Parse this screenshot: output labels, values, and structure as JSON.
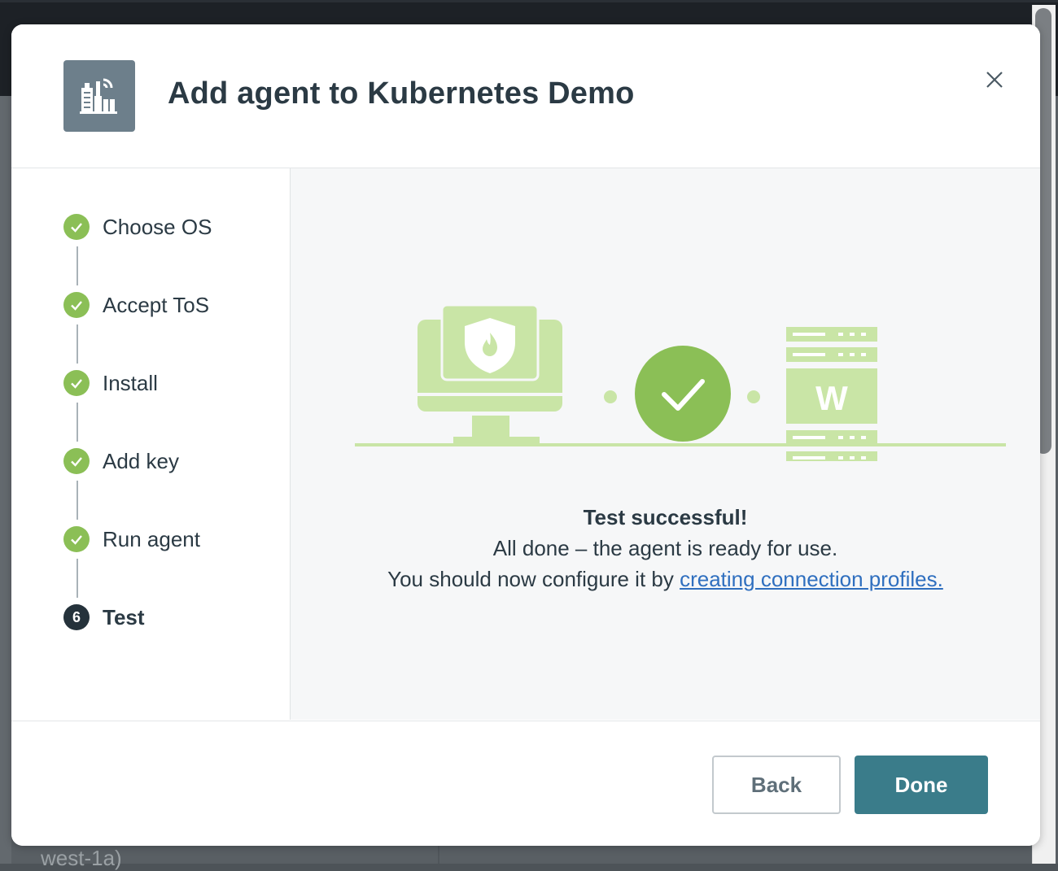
{
  "modal": {
    "title": "Add agent to Kubernetes Demo",
    "header_icon": "agent-building-icon",
    "close_icon": "close-icon"
  },
  "steps": [
    {
      "label": "Choose OS",
      "status": "done"
    },
    {
      "label": "Accept ToS",
      "status": "done"
    },
    {
      "label": "Install",
      "status": "done"
    },
    {
      "label": "Add key",
      "status": "done"
    },
    {
      "label": "Run agent",
      "status": "done"
    },
    {
      "label": "Test",
      "status": "current",
      "number": "6"
    }
  ],
  "illustration": {
    "server_letter": "W",
    "left_icon": "monitor-shield-icon",
    "center_icon": "check-circle-icon",
    "right_icon": "server-rack-icon"
  },
  "result": {
    "title": "Test successful!",
    "line1": "All done – the agent is ready for use.",
    "line2_prefix": "You should now configure it by ",
    "link_text": "creating connection profiles."
  },
  "footer": {
    "back_label": "Back",
    "done_label": "Done"
  },
  "background": {
    "peek_text": "west-1a)"
  },
  "colors": {
    "accent_green": "#8bbf56",
    "light_green": "#c9e5a6",
    "primary_button": "#3a7c8a",
    "title_text": "#2b3a44",
    "link": "#2f6fbf"
  }
}
